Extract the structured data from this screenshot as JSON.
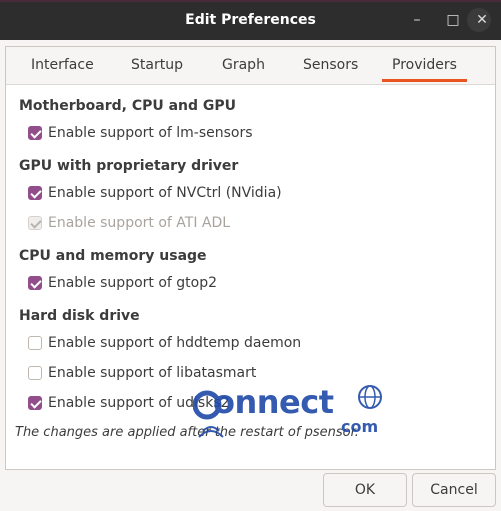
{
  "window": {
    "title": "Edit Preferences",
    "minimize_icon": "minimize-icon",
    "maximize_icon": "maximize-icon",
    "close_icon": "close-icon"
  },
  "tabs": [
    {
      "label": "Interface",
      "active": false
    },
    {
      "label": "Startup",
      "active": false
    },
    {
      "label": "Graph",
      "active": false
    },
    {
      "label": "Sensors",
      "active": false
    },
    {
      "label": "Providers",
      "active": true
    }
  ],
  "sections": [
    {
      "title": "Motherboard, CPU and GPU",
      "options": [
        {
          "label": "Enable support of lm-sensors",
          "checked": true,
          "enabled": true
        }
      ]
    },
    {
      "title": "GPU with proprietary driver",
      "options": [
        {
          "label": "Enable support of NVCtrl (NVidia)",
          "checked": true,
          "enabled": true
        },
        {
          "label": "Enable support of ATI ADL",
          "checked": true,
          "enabled": false
        }
      ]
    },
    {
      "title": "CPU and memory usage",
      "options": [
        {
          "label": "Enable support of gtop2",
          "checked": true,
          "enabled": true
        }
      ]
    },
    {
      "title": "Hard disk drive",
      "options": [
        {
          "label": "Enable support of hddtemp daemon",
          "checked": false,
          "enabled": true
        },
        {
          "label": "Enable support of libatasmart",
          "checked": false,
          "enabled": true
        },
        {
          "label": "Enable support of udisks2",
          "checked": true,
          "enabled": true
        }
      ]
    }
  ],
  "note": "The changes are applied after the restart of psensor.",
  "watermark": {
    "text": "onnect",
    "suffix": "com"
  },
  "buttons": {
    "ok": "OK",
    "cancel": "Cancel"
  },
  "colors": {
    "accent": "#e95420",
    "checkbox": "#924d8b",
    "titlebar": "#2d2d2d"
  }
}
